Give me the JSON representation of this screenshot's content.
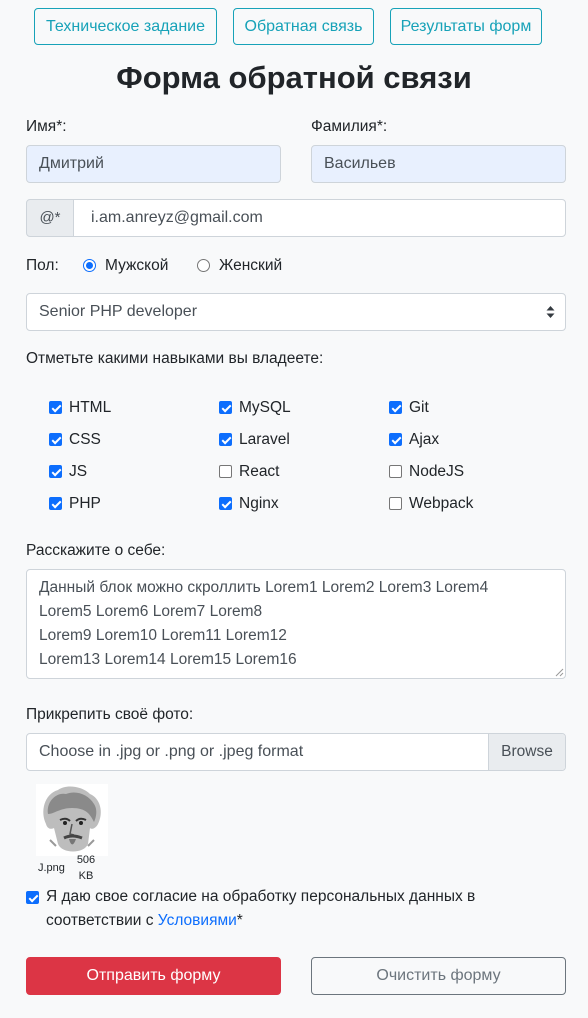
{
  "nav": {
    "spec_label": "Техническое задание",
    "feedback_label": "Обратная связь",
    "results_label": "Результаты форм"
  },
  "page": {
    "title": "Форма обратной связи"
  },
  "form": {
    "first_name": {
      "label": "Имя*:",
      "value": "Дмитрий"
    },
    "last_name": {
      "label": "Фамилия*:",
      "value": "Васильев"
    },
    "email": {
      "prepend": "@*",
      "value": "i.am.anreyz@gmail.com"
    },
    "gender": {
      "label": "Пол:",
      "options": [
        {
          "label": "Мужской",
          "checked": true
        },
        {
          "label": "Женский",
          "checked": false
        }
      ]
    },
    "position": {
      "selected": "Senior PHP developer"
    },
    "skills": {
      "label": "Отметьте какими навыками вы владеете:",
      "items": [
        {
          "label": "HTML",
          "checked": true
        },
        {
          "label": "MySQL",
          "checked": true
        },
        {
          "label": "Git",
          "checked": true
        },
        {
          "label": "CSS",
          "checked": true
        },
        {
          "label": "Laravel",
          "checked": true
        },
        {
          "label": "Ajax",
          "checked": true
        },
        {
          "label": "JS",
          "checked": true
        },
        {
          "label": "React",
          "checked": false
        },
        {
          "label": "NodeJS",
          "checked": false
        },
        {
          "label": "PHP",
          "checked": true
        },
        {
          "label": "Nginx",
          "checked": true
        },
        {
          "label": "Webpack",
          "checked": false
        }
      ]
    },
    "about": {
      "label": "Расскажите о себе:",
      "lines": [
        "Данный блок можно скроллить Lorem1 Lorem2 Lorem3 Lorem4",
        "Lorem5 Lorem6 Lorem7 Lorem8",
        "Lorem9 Lorem10 Lorem11 Lorem12",
        "Lorem13 Lorem14 Lorem15 Lorem16"
      ]
    },
    "photo": {
      "label": "Прикрепить своё фото:",
      "placeholder": "Choose in .jpg or .png or .jpeg format",
      "browse_label": "Browse",
      "file_name": "J.png",
      "file_size_value": "506",
      "file_size_unit": "KB"
    },
    "consent": {
      "checked": true,
      "text_line1": "Я даю свое согласие на обработку персональных данных в",
      "text_line2_prefix": "соответствии с ",
      "link_text": "Условиями",
      "suffix": "*"
    },
    "submit_label": "Отправить форму",
    "clear_label": "Очистить форму"
  },
  "colors": {
    "accent": "#17a2b8",
    "primary": "#0d6efd",
    "danger": "#dc3545",
    "secondary": "#6c757d",
    "autofill": "#e8f0fe"
  }
}
